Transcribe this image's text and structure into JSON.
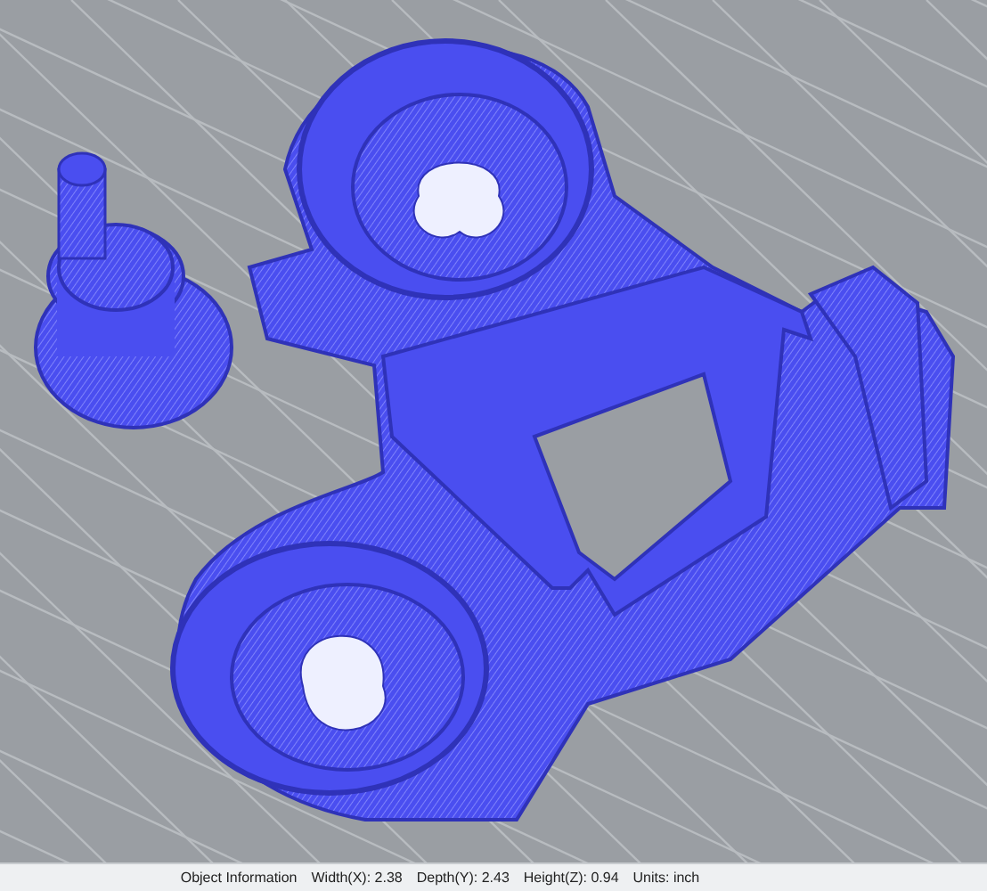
{
  "status_bar": {
    "title": "Object Information",
    "items": [
      "Width(X): 2.38",
      "Depth(Y): 2.43",
      "Height(Z): 0.94",
      "Units: inch"
    ]
  }
}
